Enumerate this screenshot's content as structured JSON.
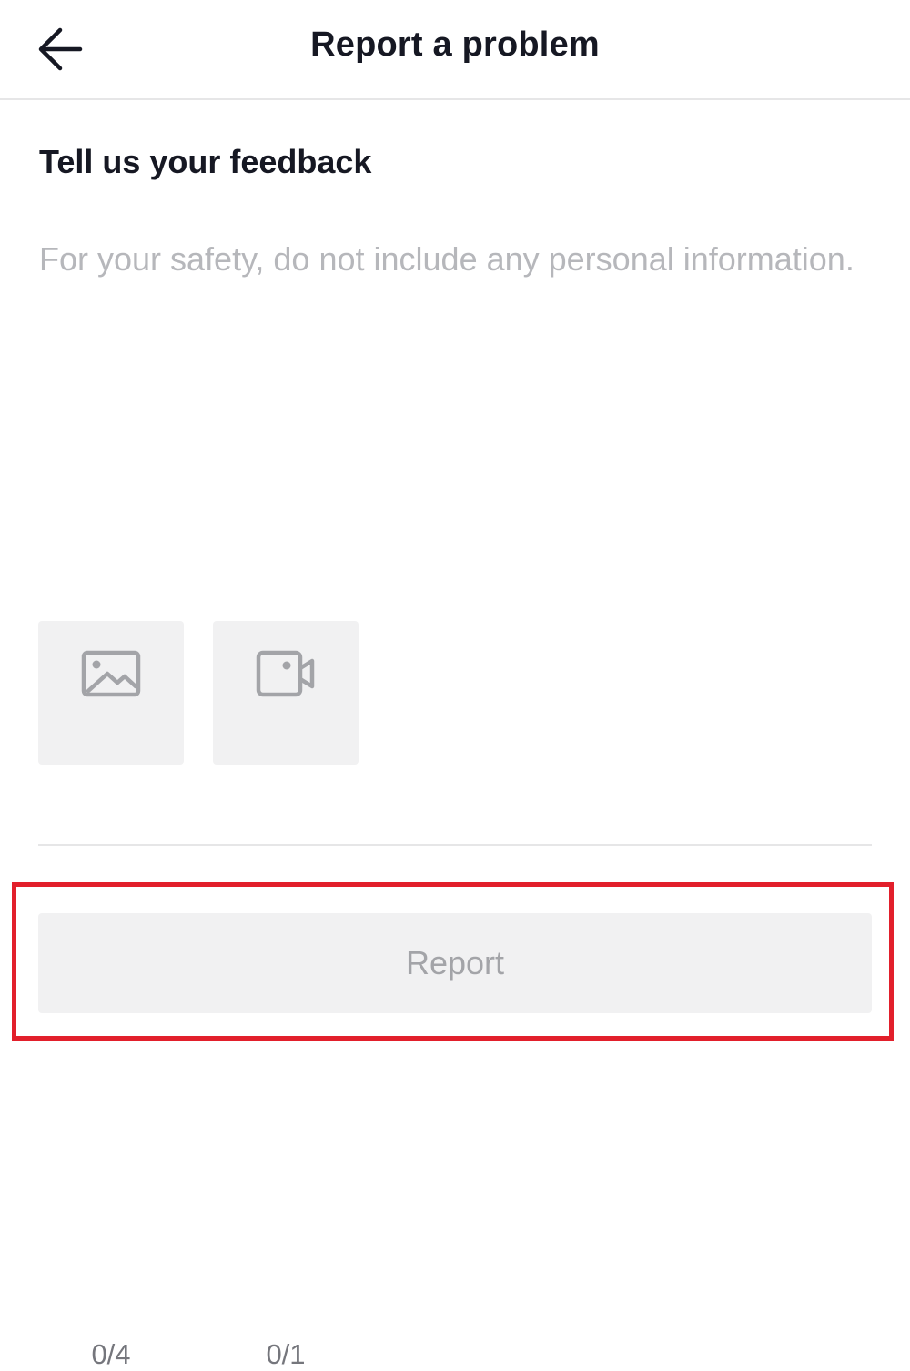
{
  "header": {
    "title": "Report a problem",
    "back_icon": "arrow-left-icon"
  },
  "feedback": {
    "section_title": "Tell us your feedback",
    "value": "",
    "placeholder": "For your safety, do not include any personal information."
  },
  "attachments": {
    "photo": {
      "icon": "image-icon",
      "count": "0/4"
    },
    "video": {
      "icon": "video-camera-icon",
      "count": "0/1"
    }
  },
  "actions": {
    "report_label": "Report",
    "report_enabled": false
  },
  "colors": {
    "text_primary": "#161823",
    "placeholder": "#b6b7bb",
    "tile_background": "#f1f1f2",
    "button_disabled_text": "#a3a4a8",
    "highlight": "#e21f2b"
  }
}
